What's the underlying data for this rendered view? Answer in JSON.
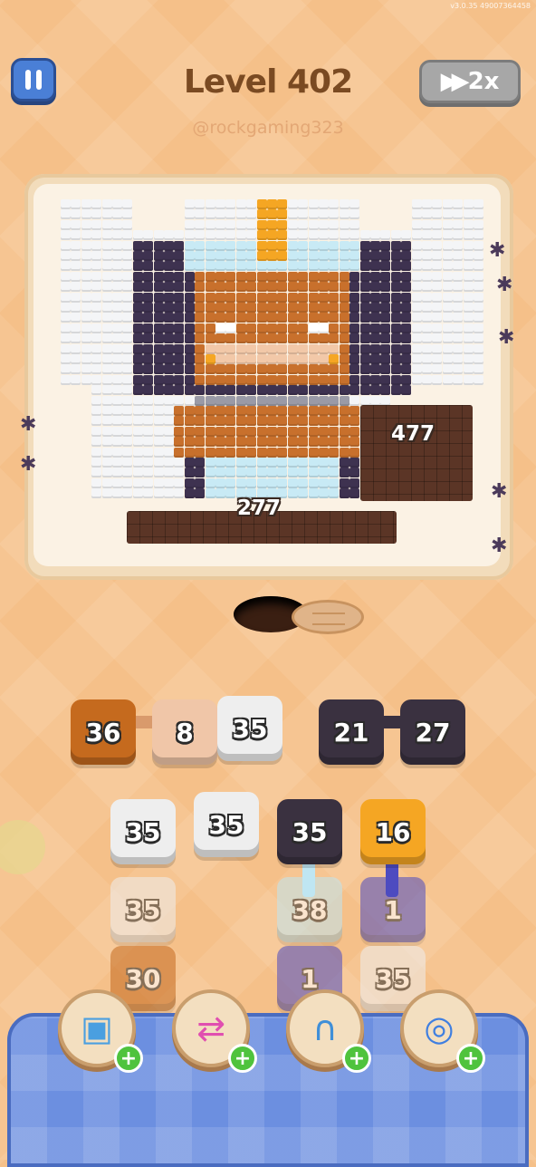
{
  "status_bar": {
    "text": "v3.0.35   49007364458"
  },
  "header": {
    "level_title": "Level 402",
    "username": "@rockgaming323",
    "speed_label": "2x"
  },
  "board": {
    "labels": {
      "bottom_block": "277",
      "right_block": "477"
    }
  },
  "tiles": [
    {
      "value": "36",
      "color": "#c56a1e"
    },
    {
      "value": "8",
      "color": "#f0c6a8"
    },
    {
      "value": "35",
      "color": "#eeeeee"
    },
    {
      "value": "21",
      "color": "#3a3140"
    },
    {
      "value": "27",
      "color": "#3a3140"
    },
    {
      "value": "35",
      "color": "#eeeeee"
    },
    {
      "value": "35",
      "color": "#eeeeee"
    },
    {
      "value": "35",
      "color": "#3a3140"
    },
    {
      "value": "16",
      "color": "#f5a623"
    },
    {
      "value": "35",
      "color": "#eeeeee"
    },
    {
      "value": "38",
      "color": "#bfe6f2"
    },
    {
      "value": "1",
      "color": "#4d4bc0"
    },
    {
      "value": "30",
      "color": "#c56a1e"
    },
    {
      "value": "1",
      "color": "#4d4bc0"
    },
    {
      "value": "35",
      "color": "#eeeeee"
    }
  ],
  "boosters": [
    {
      "name": "add-box-booster",
      "icon": "▣"
    },
    {
      "name": "shuffle-booster",
      "icon": "⇄"
    },
    {
      "name": "magnet-booster",
      "icon": "∩"
    },
    {
      "name": "bubble-booster",
      "icon": "◎"
    }
  ],
  "colors": {
    "background": "#f5c089",
    "pause_button": "#4a7fd6",
    "speed_button": "#a7a7a7",
    "bottom_panel": "#6c8fe0",
    "plus_badge": "#4fc33d"
  }
}
